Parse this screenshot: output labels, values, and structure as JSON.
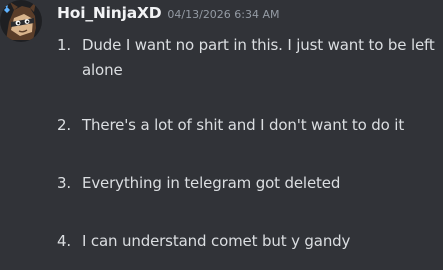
{
  "message": {
    "author": "Hoi_NinjaXD",
    "timestamp": "04/13/2026 6:34 AM",
    "avatar_icon": "ninja-avatar-icon",
    "items": [
      {
        "num": "1.",
        "text": "Dude I want no part in this. I just want to be left alone"
      },
      {
        "num": "2.",
        "text": "There's a lot of shit and I don't want to do it"
      },
      {
        "num": "3.",
        "text": "Everything in telegram got deleted"
      },
      {
        "num": "4.",
        "text": "I can understand comet but y gandy"
      }
    ]
  },
  "colors": {
    "background": "#313338",
    "username": "#f2f3f5",
    "timestamp": "#949ba4",
    "text": "#dbdee1"
  }
}
